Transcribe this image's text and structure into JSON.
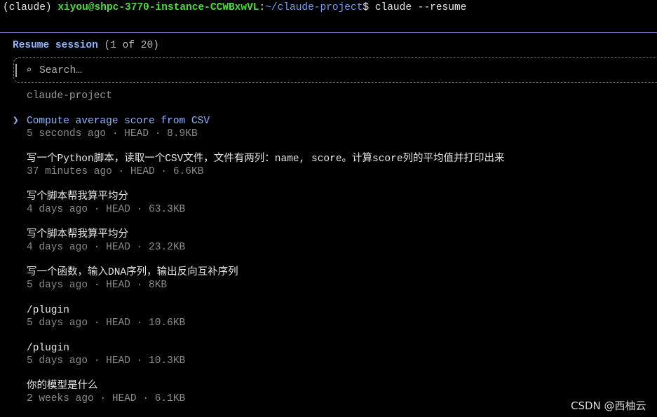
{
  "terminal": {
    "prompt_env": "(claude)",
    "prompt_user_host": "xiyou@shpc-3770-instance-CCWBxwVL",
    "prompt_colon": ":",
    "prompt_path": "~/claude-project",
    "prompt_symbol": "$",
    "command": "claude --resume"
  },
  "picker": {
    "title": "Resume session",
    "count": "(1 of 20)",
    "search_placeholder": "Search…",
    "search_icon": "search-icon",
    "group_label": "claude-project",
    "selected_marker": "❯",
    "sessions": [
      {
        "title": "Compute average score from CSV",
        "meta": "5 seconds ago · HEAD · 8.9KB",
        "selected": true
      },
      {
        "title": "写一个Python脚本，读取一个CSV文件，文件有两列：name, score。计算score列的平均值并打印出来",
        "meta": "37 minutes ago · HEAD · 6.6KB",
        "selected": false
      },
      {
        "title": "写个脚本帮我算平均分",
        "meta": "4 days ago · HEAD · 63.3KB",
        "selected": false
      },
      {
        "title": "写个脚本帮我算平均分",
        "meta": "4 days ago · HEAD · 23.2KB",
        "selected": false
      },
      {
        "title": "写一个函数，输入DNA序列，输出反向互补序列",
        "meta": "5 days ago · HEAD · 8KB",
        "selected": false
      },
      {
        "title": "/plugin",
        "meta": "5 days ago · HEAD · 10.6KB",
        "selected": false
      },
      {
        "title": "/plugin",
        "meta": "5 days ago · HEAD · 10.3KB",
        "selected": false
      },
      {
        "title": "你的模型是什么",
        "meta": "2 weeks ago · HEAD · 6.1KB",
        "selected": false
      }
    ]
  },
  "watermark": "CSDN @西柚云",
  "colors": {
    "background": "#000000",
    "user_host": "#4bdc3c",
    "path": "#6f9cff",
    "accent": "#8fb4ff",
    "meta": "#8a8a8a",
    "separator": "#7b7dc9"
  }
}
